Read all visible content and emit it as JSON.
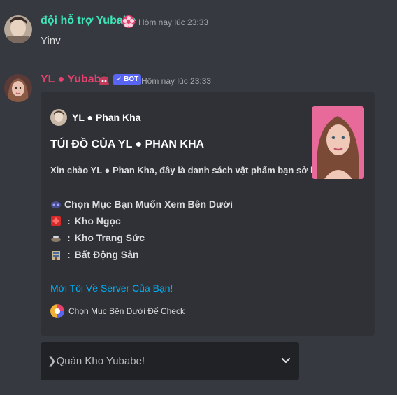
{
  "message1": {
    "username": "đội hỗ trợ Yubabe",
    "username_color": "#3ee6b8",
    "timestamp": "Hôm nay lúc 23:33",
    "content": "Yinv"
  },
  "message2": {
    "username": "YL ● Yubabe",
    "username_color": "#e5406e",
    "bot_tag": "✓ BOT",
    "timestamp": "Hôm nay lúc 23:33",
    "embed": {
      "author": "YL ● Phan Kha",
      "title": "TÚI ĐỒ CỦA YL ● PHAN KHA",
      "description": "Xin chào YL ● Phan Kha, đây là danh sách vật phẩm bạn sở hữu!.",
      "menu_header": "Chọn Mục Bạn Muốn Xem Bên Dưới",
      "menu_items": [
        {
          "icon": "ruby-icon",
          "label": "Kho Ngọc"
        },
        {
          "icon": "ring-icon",
          "label": "Kho Trang Sức"
        },
        {
          "icon": "building-icon",
          "label": "Bất Động Sản"
        }
      ],
      "link": "Mời Tôi Về Server Của Bạn!",
      "footer": "Chọn Mục Bên Dưới Để Check"
    },
    "select_menu": {
      "placeholder": "❯Quản Kho Yubabe!"
    }
  },
  "colors": {
    "background": "#36393f",
    "embed_bg": "#2f3136",
    "link": "#00aff4",
    "select_bg": "#202225"
  }
}
